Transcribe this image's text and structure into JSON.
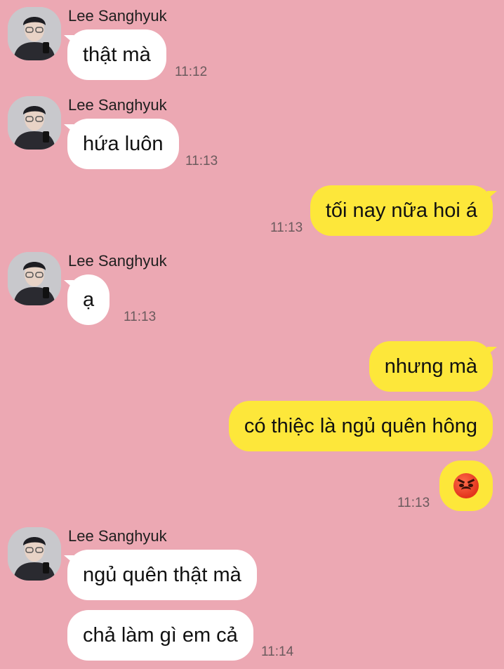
{
  "colors": {
    "background": "#eca8b3",
    "incoming_bubble": "#ffffff",
    "outgoing_bubble": "#fde73a"
  },
  "messages": [
    {
      "sender": "Lee Sanghyuk",
      "text": "thật mà",
      "time": "11:12"
    },
    {
      "sender": "Lee Sanghyuk",
      "text": "hứa luôn",
      "time": "11:13"
    },
    {
      "text": "tối nay nữa hoi á",
      "time": "11:13"
    },
    {
      "sender": "Lee Sanghyuk",
      "text": "ạ",
      "time": "11:13"
    },
    {
      "text": "nhưng mà"
    },
    {
      "text": "có thiệc là ngủ quên hông"
    },
    {
      "emoji": "angry-face-icon",
      "time": "11:13"
    },
    {
      "sender": "Lee Sanghyuk",
      "text": "ngủ quên thật mà"
    },
    {
      "text": "chả làm gì em cả",
      "time": "11:14"
    }
  ]
}
